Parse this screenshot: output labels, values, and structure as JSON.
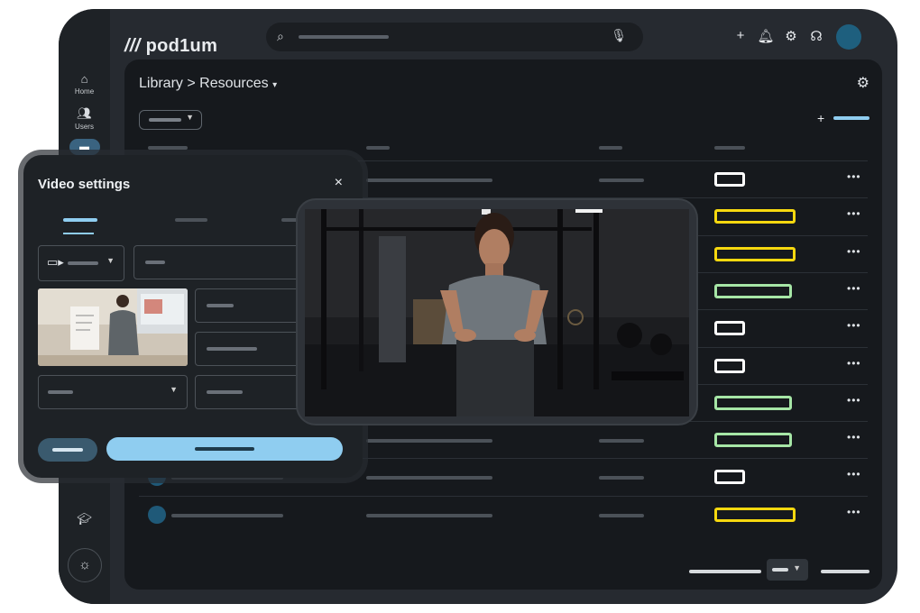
{
  "brand": {
    "name": "pod1um"
  },
  "sidebar": {
    "items": [
      {
        "label": "Home",
        "icon": "home-icon"
      },
      {
        "label": "Users",
        "icon": "users-icon"
      },
      {
        "label": "",
        "icon": "folder-icon"
      }
    ]
  },
  "header": {
    "breadcrumb": {
      "parent": "Library",
      "separator": ">",
      "current": "Resources",
      "caret": "▾"
    }
  },
  "table": {
    "rows": [
      {
        "badge": "white"
      },
      {
        "badge": "yellow"
      },
      {
        "badge": "yellow"
      },
      {
        "badge": "green"
      },
      {
        "badge": "white"
      },
      {
        "badge": "white"
      },
      {
        "badge": "green"
      },
      {
        "badge": "green"
      },
      {
        "badge": "white"
      },
      {
        "badge": "yellow"
      }
    ],
    "more_label": "•••"
  },
  "dialog": {
    "title": "Video settings",
    "close": "×"
  },
  "colors": {
    "accent": "#8fcdf0",
    "badge_yellow": "#f6d80f",
    "badge_green": "#a6e6a6",
    "badge_white": "#ffffff"
  }
}
